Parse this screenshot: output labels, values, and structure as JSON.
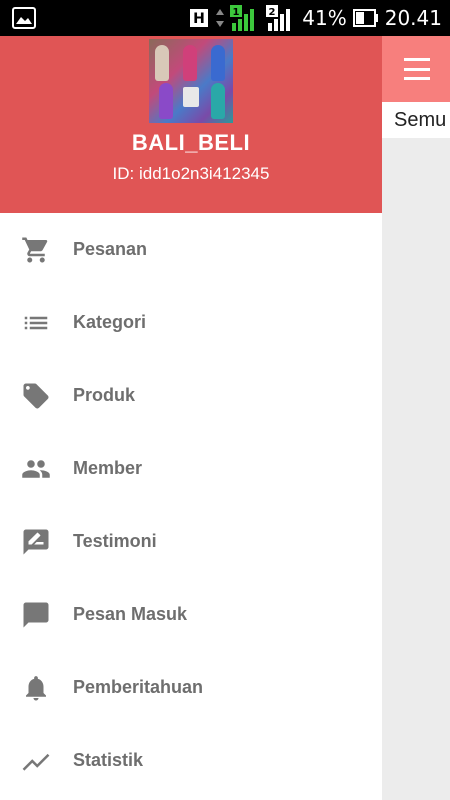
{
  "status_bar": {
    "network_label": "H",
    "sim1": "1",
    "sim2": "2",
    "battery_percent": "41%",
    "time": "20.41"
  },
  "app": {
    "tab_label": "Semu"
  },
  "drawer": {
    "store_name": "BALI_BELI",
    "store_id": "ID: idd1o2n3i412345",
    "menu": [
      {
        "label": "Pesanan",
        "icon": "cart-icon"
      },
      {
        "label": "Kategori",
        "icon": "list-icon"
      },
      {
        "label": "Produk",
        "icon": "tag-icon"
      },
      {
        "label": "Member",
        "icon": "people-icon"
      },
      {
        "label": "Testimoni",
        "icon": "rate-review-icon"
      },
      {
        "label": "Pesan Masuk",
        "icon": "message-icon"
      },
      {
        "label": "Pemberitahuan",
        "icon": "bell-icon"
      },
      {
        "label": "Statistik",
        "icon": "trending-icon"
      }
    ]
  },
  "colors": {
    "header": "#e05555",
    "toolbar": "#f77f7d",
    "icon": "#777777",
    "label": "#6e6e6e"
  }
}
